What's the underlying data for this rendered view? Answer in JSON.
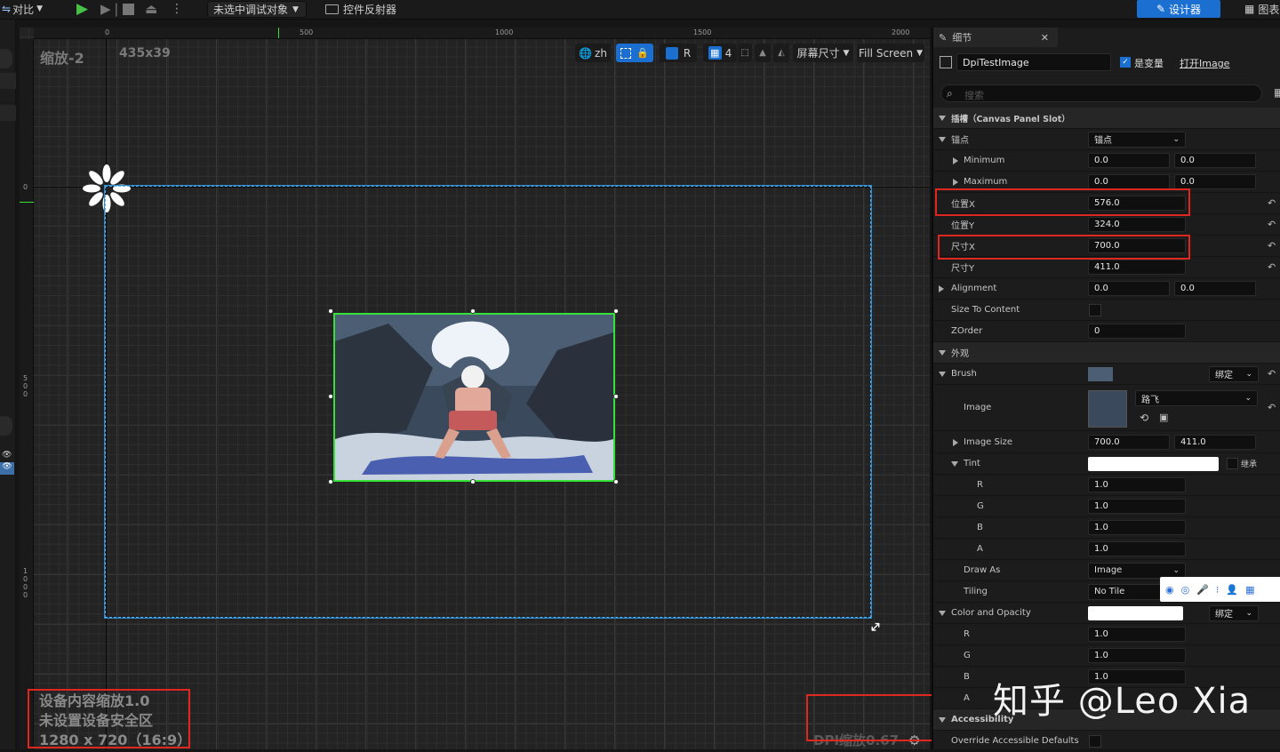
{
  "toolbar": {
    "compare_label": "对比",
    "debug_target": "未选中调试对象",
    "widget_reflector": "控件反射器",
    "designer_label": "设计器",
    "graph_label": "图表"
  },
  "ruler": {
    "top_ticks": [
      "0",
      "500",
      "1000",
      "1500",
      "2000"
    ],
    "left_ticks": [
      "0",
      "500",
      "1000"
    ]
  },
  "viewport": {
    "zoom_label": "缩放-2",
    "size_label": "435x39",
    "lang_label": "zh",
    "r_label": "R",
    "grid_value": "4",
    "screen_size_label": "屏幕尺寸",
    "fill_screen_label": "Fill Screen",
    "info_line1": "设备内容缩放1.0",
    "info_line2": "未设置设备安全区",
    "info_line3": "1280 x 720（16:9）",
    "dpi_label": "DPI缩放0.67"
  },
  "details": {
    "tab_title": "细节",
    "widget_name": "DpiTestImage",
    "is_variable_label": "是变量",
    "open_image_label": "打开Image",
    "search_placeholder": "搜索",
    "slot_section": "插槽（Canvas Panel Slot）",
    "anchors_label": "锚点",
    "anchors_value": "锚点",
    "minimum_label": "Minimum",
    "minimum_x": "0.0",
    "minimum_y": "0.0",
    "maximum_label": "Maximum",
    "maximum_x": "0.0",
    "maximum_y": "0.0",
    "pos_x_label": "位置X",
    "pos_x_value": "576.0",
    "pos_y_label": "位置Y",
    "pos_y_value": "324.0",
    "size_x_label": "尺寸X",
    "size_x_value": "700.0",
    "size_y_label": "尺寸Y",
    "size_y_value": "411.0",
    "alignment_label": "Alignment",
    "alignment_x": "0.0",
    "alignment_y": "0.0",
    "size_to_content_label": "Size To Content",
    "zorder_label": "ZOrder",
    "zorder_value": "0",
    "appearance_section": "外观",
    "brush_label": "Brush",
    "bind_label": "绑定",
    "image_label": "Image",
    "image_asset": "路飞",
    "image_size_label": "Image Size",
    "image_size_x": "700.0",
    "image_size_y": "411.0",
    "tint_label": "Tint",
    "inherit_label": "继承",
    "r_label": "R",
    "r_value": "1.0",
    "g_label": "G",
    "g_value": "1.0",
    "b_label": "B",
    "b_value": "1.0",
    "a_label": "A",
    "a_value": "1.0",
    "draw_as_label": "Draw As",
    "draw_as_value": "Image",
    "tiling_label": "Tiling",
    "tiling_value": "No Tile",
    "color_opacity_label": "Color and Opacity",
    "co_r_label": "R",
    "co_r_value": "1.0",
    "co_g_label": "G",
    "co_g_value": "1.0",
    "co_b_label": "B",
    "co_b_value": "1.0",
    "co_a_label": "A",
    "accessibility_section": "Accessibility",
    "override_label": "Override Accessible Defaults"
  },
  "watermark": "知乎 @Leo Xia",
  "colors": {
    "accent_blue": "#1a6fd1",
    "selection_green": "#34e23a",
    "frame_blue": "#4bb6ff",
    "highlight_red": "#e0271f"
  }
}
